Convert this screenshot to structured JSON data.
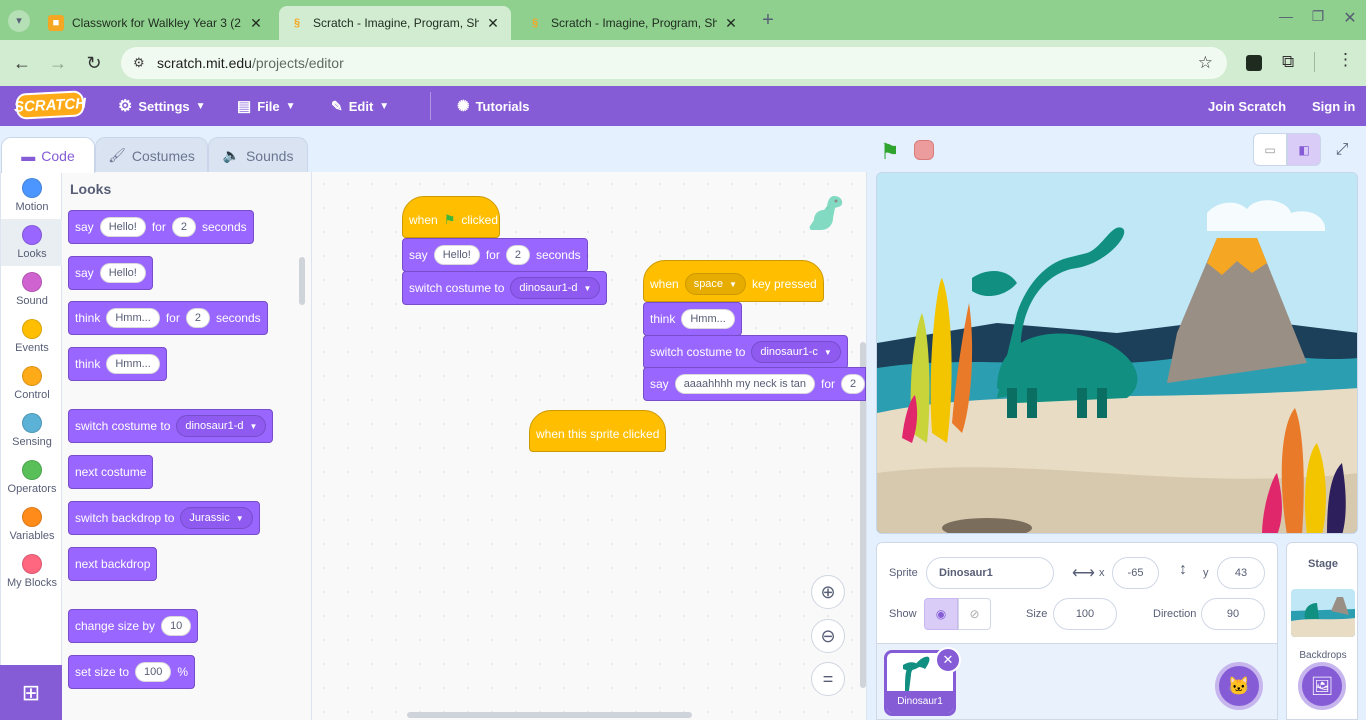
{
  "browser": {
    "tabs": [
      {
        "title": "Classwork for Walkley Year 3 (2",
        "icon": "classroom-icon"
      },
      {
        "title": "Scratch - Imagine, Program, Sh",
        "icon": "scratch-icon"
      },
      {
        "title": "Scratch - Imagine, Program, Sh",
        "icon": "scratch-icon"
      }
    ],
    "url_domain": "scratch.mit.edu",
    "url_path": "/projects/editor"
  },
  "menu": {
    "logo": "SCRATCH",
    "settings": "Settings",
    "file": "File",
    "edit": "Edit",
    "tutorials": "Tutorials",
    "join": "Join Scratch",
    "signin": "Sign in"
  },
  "editor_tabs": {
    "code": "Code",
    "costumes": "Costumes",
    "sounds": "Sounds"
  },
  "categories": [
    {
      "label": "Motion",
      "color": "#4c97ff"
    },
    {
      "label": "Looks",
      "color": "#9966ff"
    },
    {
      "label": "Sound",
      "color": "#cf63cf"
    },
    {
      "label": "Events",
      "color": "#ffbf00"
    },
    {
      "label": "Control",
      "color": "#ffab19"
    },
    {
      "label": "Sensing",
      "color": "#5cb1d6"
    },
    {
      "label": "Operators",
      "color": "#59c059"
    },
    {
      "label": "Variables",
      "color": "#ff8c1a"
    },
    {
      "label": "My Blocks",
      "color": "#ff6680"
    }
  ],
  "palette": {
    "heading": "Looks",
    "say_secs": {
      "a": "say",
      "msg": "Hello!",
      "b": "for",
      "n": "2",
      "c": "seconds"
    },
    "say": {
      "a": "say",
      "msg": "Hello!"
    },
    "think_secs": {
      "a": "think",
      "msg": "Hmm...",
      "b": "for",
      "n": "2",
      "c": "seconds"
    },
    "think": {
      "a": "think",
      "msg": "Hmm..."
    },
    "switch_costume": {
      "a": "switch costume to",
      "v": "dinosaur1-d"
    },
    "next_costume": "next costume",
    "switch_backdrop": {
      "a": "switch backdrop to",
      "v": "Jurassic"
    },
    "next_backdrop": "next backdrop",
    "change_size": {
      "a": "change size by",
      "n": "10"
    },
    "set_size": {
      "a": "set size to",
      "n": "100",
      "c": "%"
    }
  },
  "scripts": {
    "s1": {
      "hat_a": "when",
      "hat_b": "clicked",
      "say": {
        "a": "say",
        "msg": "Hello!",
        "b": "for",
        "n": "2",
        "c": "seconds"
      },
      "costume": {
        "a": "switch costume to",
        "v": "dinosaur1-d"
      }
    },
    "s2": {
      "hat_a": "when",
      "key": "space",
      "hat_b": "key pressed",
      "think": {
        "a": "think",
        "msg": "Hmm..."
      },
      "costume": {
        "a": "switch costume to",
        "v": "dinosaur1-c"
      },
      "say": {
        "a": "say",
        "msg": "aaaahhhh my neck is tan",
        "b": "for",
        "n": "2"
      }
    },
    "s3": {
      "hat": "when this sprite clicked"
    }
  },
  "sprite_info": {
    "sprite_label": "Sprite",
    "sprite_name": "Dinosaur1",
    "x_label": "x",
    "x": "-65",
    "y_label": "y",
    "y": "43",
    "show_label": "Show",
    "size_label": "Size",
    "size": "100",
    "direction_label": "Direction",
    "direction": "90"
  },
  "sprites": [
    {
      "name": "Dinosaur1"
    }
  ],
  "stage_panel": {
    "title": "Stage",
    "backdrops": "Backdrops"
  }
}
